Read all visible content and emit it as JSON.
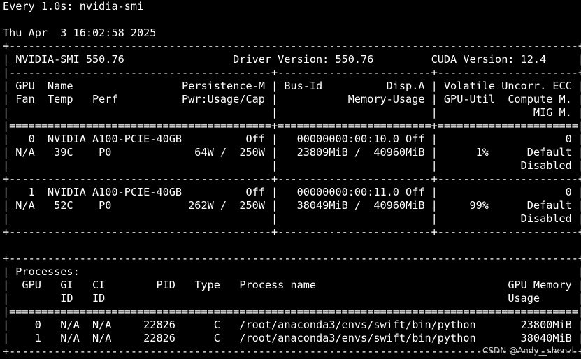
{
  "theme": {
    "background": "#000000",
    "foreground": "#ffffff",
    "watermark_color": "#cfcfcf"
  },
  "terminal": {
    "lines": [
      "Every 1.0s: nvidia-smi",
      "",
      "Thu Apr  3 16:02:58 2025",
      "+-----------------------------------------------------------------------------------------+",
      "| NVIDIA-SMI 550.76                 Driver Version: 550.76         CUDA Version: 12.4     |",
      "|-----------------------------------------+------------------------+----------------------+",
      "| GPU  Name                 Persistence-M | Bus-Id          Disp.A | Volatile Uncorr. ECC |",
      "| Fan  Temp   Perf          Pwr:Usage/Cap |           Memory-Usage | GPU-Util  Compute M. |",
      "|                                         |                        |               MIG M. |",
      "|=========================================+========================+======================|",
      "|   0  NVIDIA A100-PCIE-40GB          Off |   00000000:00:10.0 Off |                    0 |",
      "| N/A   39C    P0             64W /  250W |   23809MiB /  40960MiB |      1%      Default |",
      "|                                         |                        |             Disabled |",
      "+-----------------------------------------+------------------------+----------------------+",
      "|   1  NVIDIA A100-PCIE-40GB          Off |   00000000:00:11.0 Off |                    0 |",
      "| N/A   52C    P0            262W /  250W |   38049MiB /  40960MiB |     99%      Default |",
      "|                                         |                        |             Disabled |",
      "+-----------------------------------------+------------------------+----------------------+",
      "",
      "+-----------------------------------------------------------------------------------------+",
      "| Processes:                                                                              |",
      "|  GPU   GI   CI        PID   Type   Process name                              GPU Memory |",
      "|        ID   ID                                                               Usage      |",
      "|=========================================================================================|",
      "|    0   N/A  N/A     22826      C   /root/anaconda3/envs/swift/bin/python       23800MiB |",
      "|    1   N/A  N/A     22826      C   /root/anaconda3/envs/swift/bin/python       38040MiB |",
      "+-----------------------------------------------------------------------------------------+"
    ]
  },
  "watermark": {
    "text": "CSDN @Andy__shenzl"
  }
}
